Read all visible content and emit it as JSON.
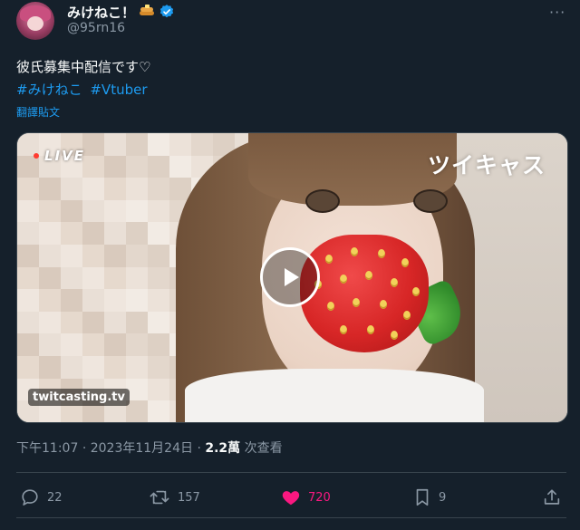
{
  "author": {
    "display_name": "みけねこ！",
    "handle": "@95rn16"
  },
  "more_label": "···",
  "tweet": {
    "text": "彼氏募集中配信です♡",
    "hashtags": [
      "#みけねこ",
      "#Vtuber"
    ],
    "translate_label": "翻譯貼文"
  },
  "media": {
    "live_label": "LIVE",
    "brand_label": "ツイキャス",
    "watermark": "twitcasting.tv"
  },
  "meta": {
    "time": "下午11:07",
    "date": "2023年11月24日",
    "views": "2.2萬",
    "views_label": "次查看",
    "separator": "·"
  },
  "actions": {
    "reply_count": "22",
    "retweet_count": "157",
    "like_count": "720",
    "bookmark_count": "9"
  },
  "colors": {
    "background": "#15202b",
    "accent": "#1d9bf0",
    "like": "#f91880",
    "muted": "#8b98a5"
  }
}
